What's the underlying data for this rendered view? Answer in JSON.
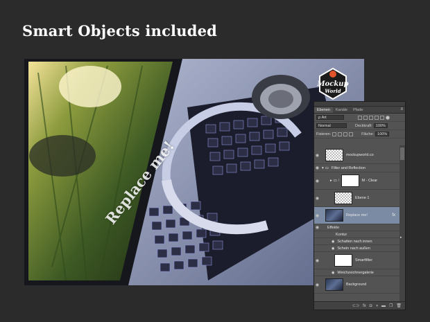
{
  "headline": "Smart Objects included",
  "badge": {
    "line1": "Mockup",
    "line2": "World"
  },
  "screen_text": "Replace me!",
  "panel": {
    "tabs": [
      "Ebenen",
      "Kanäle",
      "Pfade"
    ],
    "menu_icon": "≡",
    "filter_kind": "ρ Art",
    "blend_mode": "Normal",
    "opacity_label": "Deckkraft:",
    "opacity_value": "100%",
    "lock_label": "Fixieren:",
    "fill_label": "Fläche:",
    "fill_value": "100%",
    "layers": [
      {
        "name": "mockupworld.co"
      },
      {
        "name": "Filter and Reflection"
      },
      {
        "name": "M - Clear"
      },
      {
        "name": "Ebene 1"
      },
      {
        "name": "Replace me!"
      },
      {
        "name": "Effekte"
      },
      {
        "name": "Kontur"
      },
      {
        "name": "Schatten nach innen"
      },
      {
        "name": "Schein nach außen"
      },
      {
        "name": "Smartfilter"
      },
      {
        "name": "Weichzeichnergalerie"
      },
      {
        "name": "Background"
      }
    ],
    "fx_label": "fx",
    "bottom_icons": [
      "⊂⊃",
      "fx",
      "◘",
      "◑",
      "▬",
      "❐",
      "🗑"
    ]
  },
  "colors": {
    "background": "#2b2b2b",
    "panel": "#535353",
    "selection": "#7b8ba4"
  }
}
